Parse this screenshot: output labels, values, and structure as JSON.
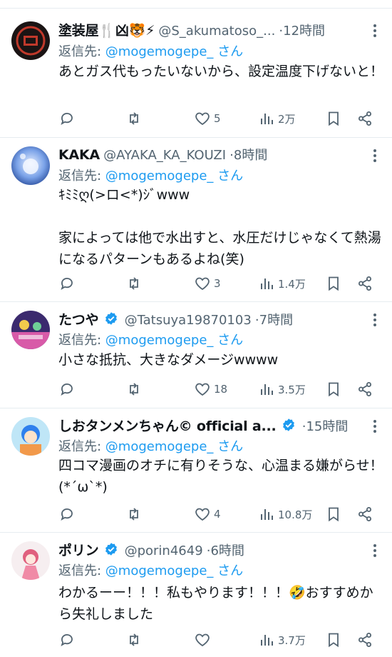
{
  "colors": {
    "link": "#1d9bf0",
    "muted": "#536471",
    "text": "#0f1419",
    "verified": "#1d9bf0"
  },
  "reply_prefix": "返信先: ",
  "reply_suffix": " さん",
  "tweets": [
    {
      "name": "塗装屋🍴凶🐯⚡",
      "handle": "@S_akumatoso_...",
      "verified": false,
      "time": "12時間",
      "mention": "@mogemogepe_",
      "text": "あとガス代もったいないから、設定温度下げないと！",
      "replies": "",
      "retweets": "",
      "likes": "5",
      "views": "2万"
    },
    {
      "name": "KAKA",
      "handle": "@AYAKA_KA_KOUZI",
      "verified": false,
      "time": "8時間",
      "mention": "@mogemogepe_",
      "text": "ｷﾐﾐღ(>ロ<*)ｼﾞwww\n\n家によっては他で水出すと、水圧だけじゃなくて熱湯になるパターンもあるよね(笑)",
      "replies": "",
      "retweets": "",
      "likes": "3",
      "views": "1.4万"
    },
    {
      "name": "たつや",
      "handle": "@Tatsuya19870103",
      "verified": true,
      "time": "7時間",
      "mention": "@mogemogepe_",
      "text": "小さな抵抗、大きなダメージwwww",
      "replies": "",
      "retweets": "",
      "likes": "18",
      "views": "3.5万"
    },
    {
      "name": "しおタンメンちゃん© official a...",
      "handle": "",
      "verified": true,
      "time": "15時間",
      "mention": "@mogemogepe_",
      "text": "四コマ漫画のオチに有りそうな、心温まる嫌がらせ！ (*´ω`*)",
      "replies": "",
      "retweets": "",
      "likes": "4",
      "views": "10.8万"
    },
    {
      "name": "ポリン",
      "handle": "@porin4649",
      "verified": true,
      "time": "6時間",
      "mention": "@mogemogepe_",
      "text": "わかるーー！！！私もやります！！！🤣おすすめから失礼しました",
      "replies": "",
      "retweets": "",
      "likes": "",
      "views": "3.7万"
    }
  ]
}
